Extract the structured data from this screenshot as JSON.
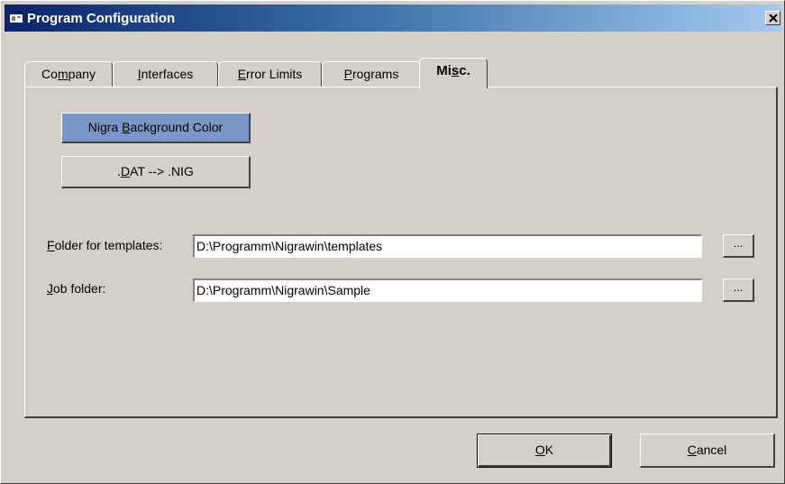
{
  "window": {
    "title": "Program Configuration",
    "close_icon": "close-icon",
    "app_icon": "app-icon"
  },
  "tabs": [
    {
      "pre": "Co",
      "u": "m",
      "post": "pany"
    },
    {
      "pre": "",
      "u": "I",
      "post": "nterfaces"
    },
    {
      "pre": "",
      "u": "E",
      "post": "rror Limits"
    },
    {
      "pre": "",
      "u": "P",
      "post": "rograms"
    },
    {
      "pre": "Mi",
      "u": "s",
      "post": "c."
    }
  ],
  "misc": {
    "bg_color_button": {
      "pre": "Nigra ",
      "u": "B",
      "post": "ackground Color"
    },
    "dat_button": {
      "pre": ".",
      "u": "D",
      "post": "AT --> .NIG"
    },
    "templates_label": {
      "pre": "",
      "u": "F",
      "post": "older for templates:"
    },
    "templates_value": "D:\\Programm\\Nigrawin\\templates",
    "job_label": {
      "pre": "",
      "u": "J",
      "post": "ob folder:"
    },
    "job_value": "D:\\Programm\\Nigrawin\\Sample",
    "browse_label": "...",
    "bg_color": "#7b97c9"
  },
  "footer": {
    "ok": {
      "pre": "",
      "u": "O",
      "post": "K"
    },
    "cancel": {
      "pre": "",
      "u": "C",
      "post": "ancel"
    }
  }
}
